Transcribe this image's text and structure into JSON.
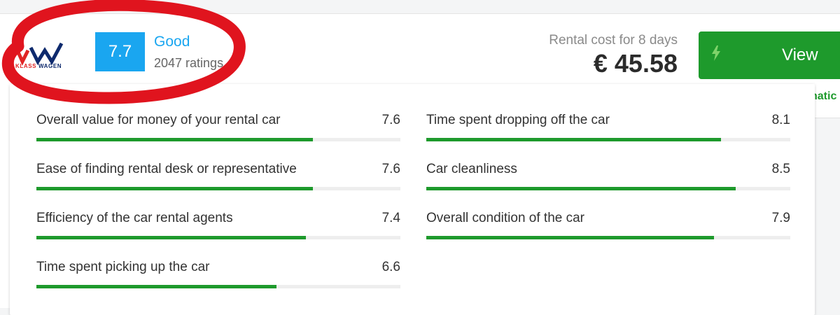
{
  "vendor": {
    "logo_text_klass": "KLASS",
    "logo_text_wagen": "WAGEN"
  },
  "rating": {
    "score": "7.7",
    "word": "Good",
    "count_text": "2047 ratings"
  },
  "pricing": {
    "label": "Rental cost for 8 days",
    "value": "€ 45.58"
  },
  "view_button": {
    "label": "View",
    "icon": "lightning-bolt-icon"
  },
  "info_link_partial": "natic",
  "colors": {
    "badge": "#1aa6f0",
    "accent_green": "#1e9a2c",
    "highlight_red": "#e0141e"
  },
  "metrics_left": [
    {
      "label": "Overall value for money of your rental car",
      "value": "7.6",
      "score": 7.6
    },
    {
      "label": "Ease of finding rental desk or representative",
      "value": "7.6",
      "score": 7.6
    },
    {
      "label": "Efficiency of the car rental agents",
      "value": "7.4",
      "score": 7.4
    },
    {
      "label": "Time spent picking up the car",
      "value": "6.6",
      "score": 6.6
    }
  ],
  "metrics_right": [
    {
      "label": "Time spent dropping off the car",
      "value": "8.1",
      "score": 8.1
    },
    {
      "label": "Car cleanliness",
      "value": "8.5",
      "score": 8.5
    },
    {
      "label": "Overall condition of the car",
      "value": "7.9",
      "score": 7.9
    }
  ],
  "score_max": 10
}
